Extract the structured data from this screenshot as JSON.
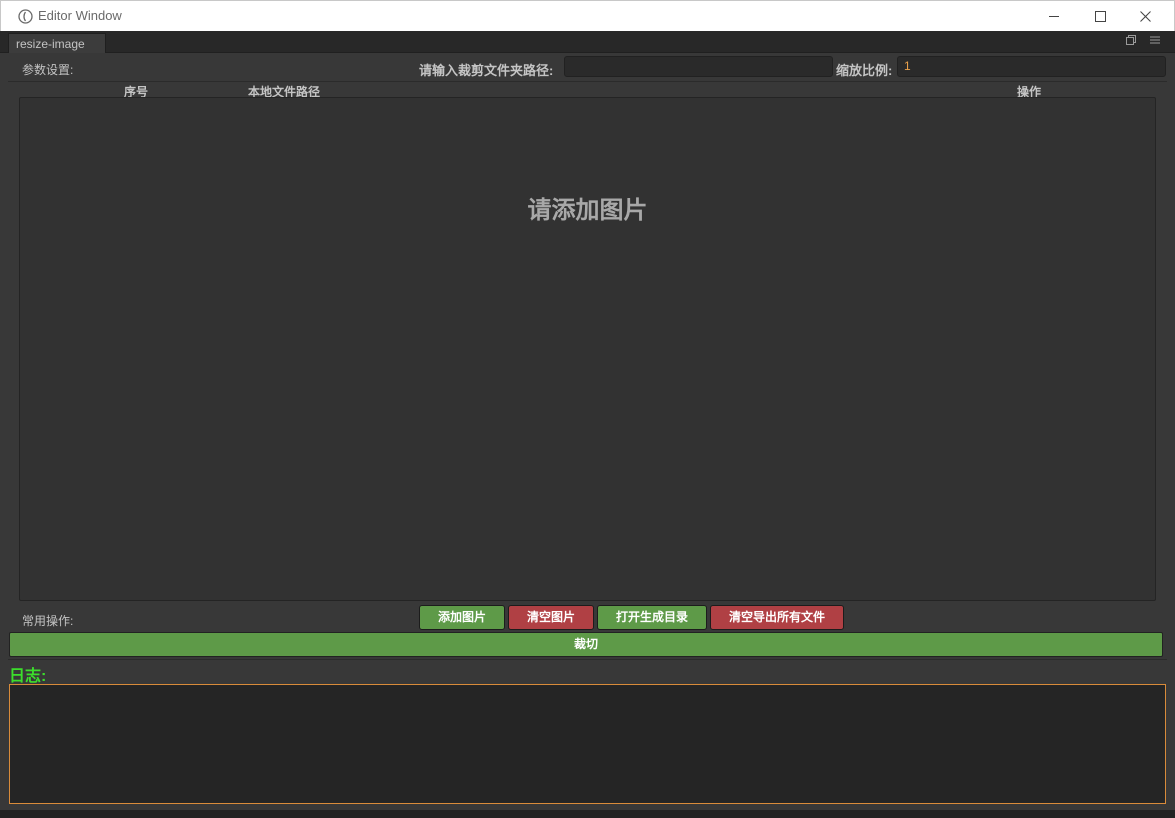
{
  "window": {
    "title": "Editor Window",
    "min_icon": "minimize-icon",
    "max_icon": "maximize-icon",
    "close_icon": "close-icon"
  },
  "tab": {
    "label": "resize-image",
    "popout_icon": "popout-icon",
    "menu_icon": "menu-icon"
  },
  "params": {
    "section_label": "参数设置:",
    "folder_label": "请输入裁剪文件夹路径:",
    "folder_value": "",
    "scale_label": "缩放比例:",
    "scale_value": "1"
  },
  "table": {
    "columns": [
      "序号",
      "本地文件路径",
      "操作"
    ],
    "empty_text": "请添加图片"
  },
  "actions": {
    "section_label": "常用操作:",
    "add_images": "添加图片",
    "clear_images": "清空图片",
    "open_output_dir": "打开生成目录",
    "clear_exported": "清空导出所有文件",
    "crop": "裁切"
  },
  "log": {
    "title": "日志:",
    "content": ""
  },
  "colors": {
    "green_button": "#5e9a48",
    "red_button": "#b04044",
    "log_title": "#3cde2c",
    "log_border": "#d98b3a",
    "scale_value": "#e8a04a"
  }
}
